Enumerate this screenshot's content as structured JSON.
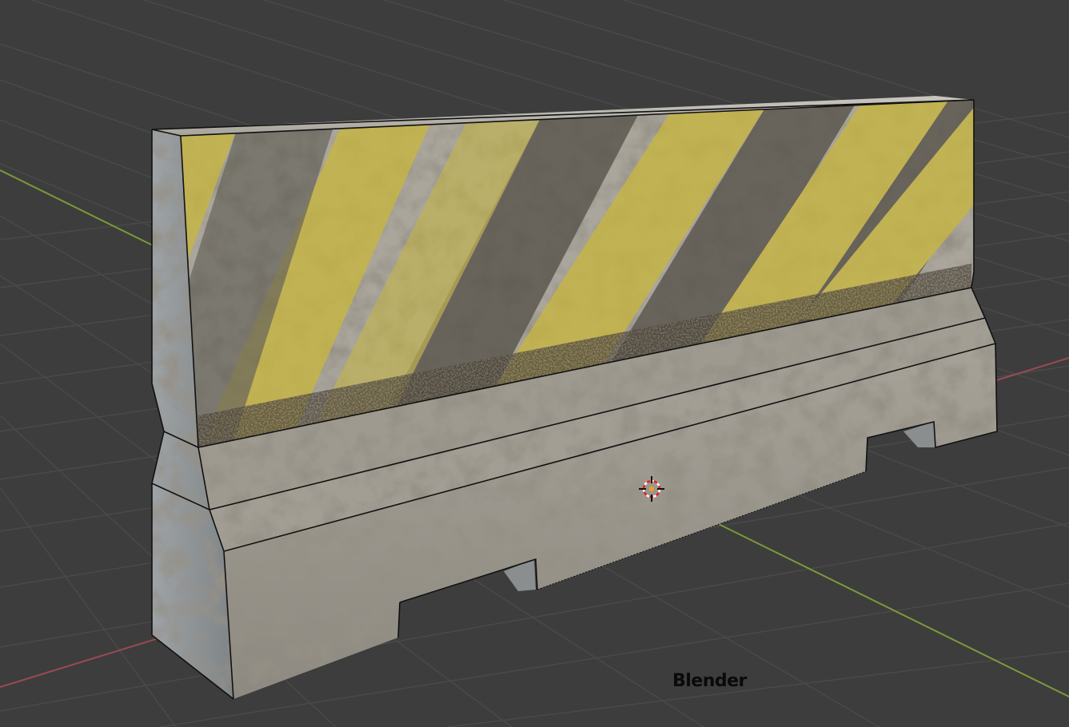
{
  "app": "Blender",
  "viewport": {
    "caption": "Blender",
    "object": "concrete-barrier",
    "colors": {
      "background": "#3d3d3d",
      "grid_line": "#4a4a4a",
      "x_axis": "#9a4a52",
      "y_axis": "#7a9a3a",
      "concrete_light": "#b9b6ad",
      "concrete_dark": "#56524a",
      "hazard_yellow": "#c8b640",
      "dirt": "#4a4134"
    },
    "icons": [
      "3d-cursor-icon"
    ]
  }
}
